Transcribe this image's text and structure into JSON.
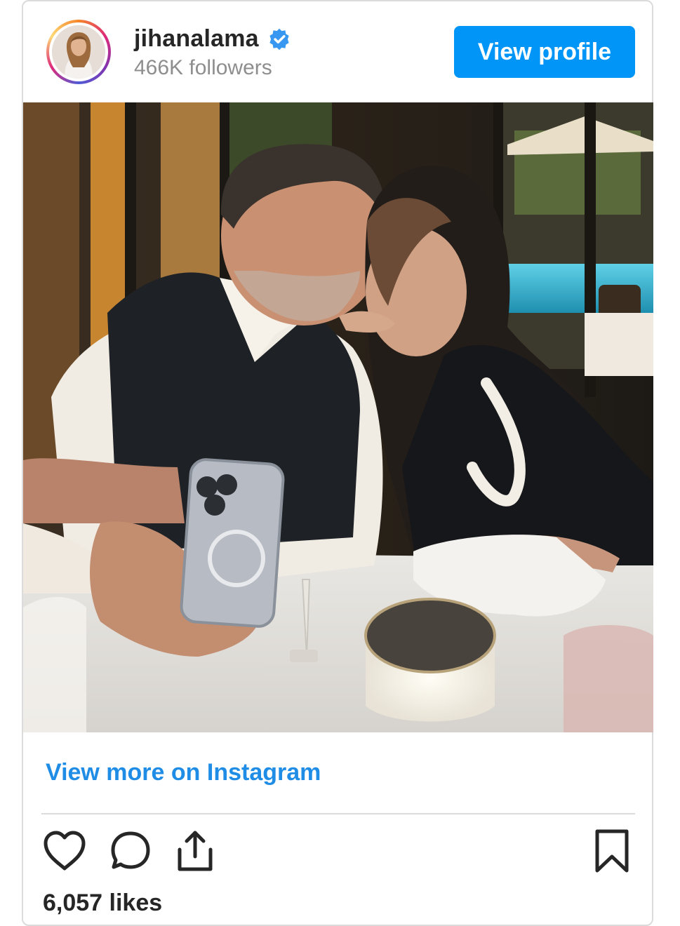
{
  "post": {
    "username": "jihanalama",
    "followers": "466K followers",
    "view_profile_label": "View profile",
    "view_more_label": "View more on Instagram",
    "likes": "6,057 likes"
  },
  "icons": {
    "verified": "verified-badge-icon",
    "like": "heart-icon",
    "comment": "comment-bubble-icon",
    "share": "share-icon",
    "save": "bookmark-icon"
  },
  "colors": {
    "primary_button": "#0095f6",
    "link": "#1f8ce6",
    "verified": "#3897f0",
    "text": "#262626",
    "muted": "#8e8e8e"
  }
}
